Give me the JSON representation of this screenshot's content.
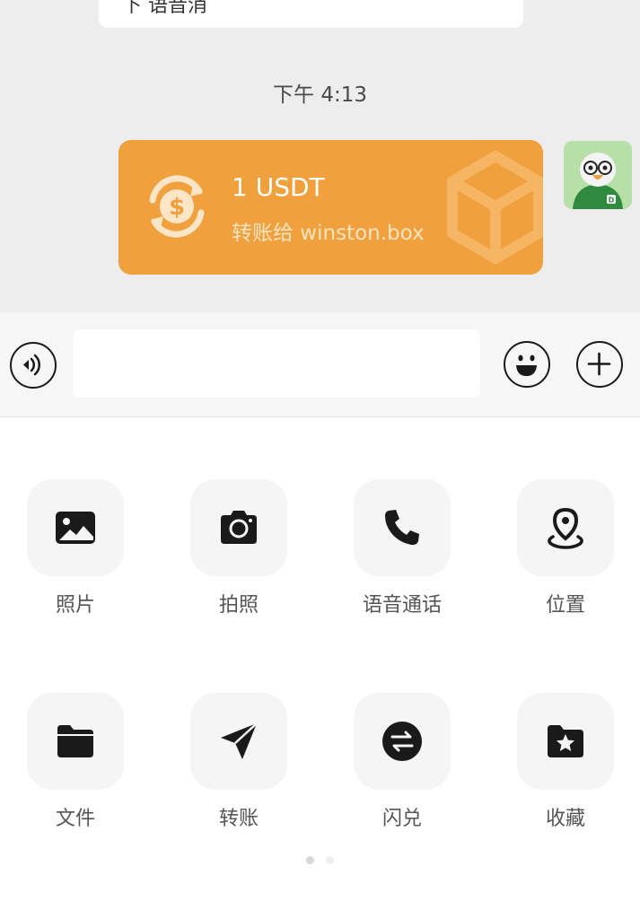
{
  "chat": {
    "previous_message_fragment": "下 语音消",
    "timestamp": "下午 4:13",
    "transfer": {
      "amount": "1 USDT",
      "description": "转账给 winston.box",
      "card_color": "#f0a13d"
    }
  },
  "input_bar": {
    "message_value": "",
    "voice_icon": "voice-icon",
    "emoji_icon": "emoji-icon",
    "plus_icon": "plus-icon"
  },
  "actions": [
    {
      "label": "照片",
      "icon": "photo-icon"
    },
    {
      "label": "拍照",
      "icon": "camera-icon"
    },
    {
      "label": "语音通话",
      "icon": "phone-icon"
    },
    {
      "label": "位置",
      "icon": "location-icon"
    },
    {
      "label": "文件",
      "icon": "folder-icon"
    },
    {
      "label": "转账",
      "icon": "send-icon"
    },
    {
      "label": "闪兑",
      "icon": "exchange-icon"
    },
    {
      "label": "收藏",
      "icon": "favorites-icon"
    }
  ],
  "pagination": {
    "pages": 2,
    "current": 1
  }
}
